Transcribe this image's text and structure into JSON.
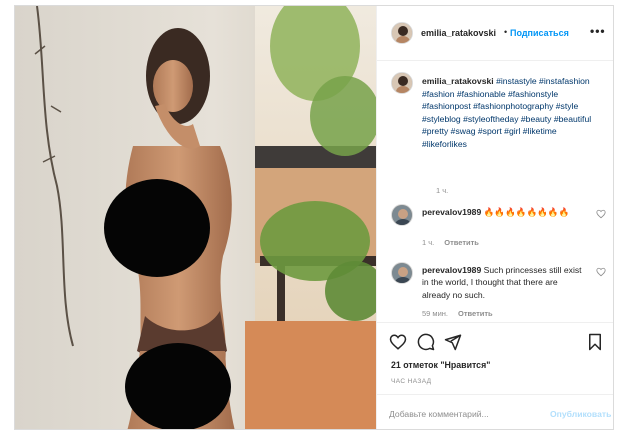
{
  "post": {
    "author": {
      "username": "emilia_ratakovski",
      "follow_label": "Подписаться",
      "separator": "•",
      "more_label": "•••"
    },
    "caption": {
      "username": "emilia_ratakovski",
      "hashtags": "#instastyle #instafashion #fashion #fashionable #fashionstyle #fashionpost #fashionphotography #style #styleblog #styleoftheday #beauty #beautiful #pretty #swag #sport #girl #liketime #likeforlikes",
      "time": "1 ч."
    },
    "comments": [
      {
        "username": "perevalov1989",
        "text": "🔥🔥🔥🔥🔥🔥🔥🔥",
        "time": "1 ч.",
        "reply_label": "Ответить"
      },
      {
        "username": "perevalov1989",
        "text": "Such princesses still exist in the world, I thought that there are already no such.",
        "time": "59 мин.",
        "reply_label": "Ответить"
      }
    ],
    "likes_text": "21 отметок \"Нравится\"",
    "time_ago": "ЧАС НАЗАД",
    "comment_input": {
      "placeholder": "Добавьте комментарий...",
      "value": ""
    },
    "publish_label": "Опубликовать",
    "icons": {
      "like": "heart-icon",
      "comment": "comment-icon",
      "share": "share-icon",
      "save": "bookmark-icon",
      "comment_like": "heart-icon"
    },
    "colors": {
      "link_blue": "#0095f6",
      "hashtag": "#00376b",
      "muted": "#8e8e8e",
      "publish_disabled": "#b2dffc",
      "border": "#dbdbdb"
    }
  }
}
